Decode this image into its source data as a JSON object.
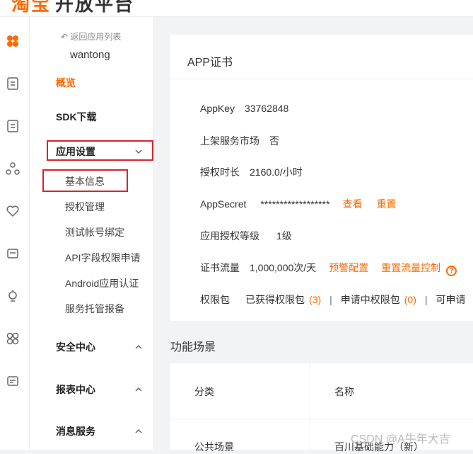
{
  "header": {
    "brand_main": "淘宝",
    "brand_rest": "开放平台"
  },
  "sidebar": {
    "back_label": "返回应用列表",
    "app_name": "wantong",
    "overview": "概览",
    "sdk": "SDK下载",
    "app_settings": "应用设置",
    "sub_items": [
      "基本信息",
      "授权管理",
      "测试帐号绑定",
      "API字段权限申请",
      "Android应用认证",
      "服务托管报备"
    ],
    "security": "安全中心",
    "reports": "报表中心",
    "messages": "消息服务"
  },
  "cert": {
    "title": "APP证书",
    "appkey_label": "AppKey",
    "appkey_value": "33762848",
    "market_label": "上架服务市场",
    "market_value": "否",
    "duration_label": "授权时长",
    "duration_value": "2160.0/小时",
    "secret_label": "AppSecret",
    "secret_value": "******************",
    "view_link": "查看",
    "reset_link": "重置",
    "level_label": "应用授权等级",
    "level_value": "1级",
    "traffic_label": "证书流量",
    "traffic_value": "1,000,000次/天",
    "alert_link": "预警配置",
    "reset_traffic_link": "重置流量控制",
    "perm_label": "权限包",
    "obtained_label": "已获得权限包",
    "obtained_count": "(3)",
    "applying_label": "申请中权限包",
    "applying_count": "(0)",
    "applicable_label": "可申请"
  },
  "scenes": {
    "title": "功能场景",
    "col_category": "分类",
    "col_name": "名称",
    "row_category": "公共场景",
    "row_name": "百川基础能力（新）"
  },
  "watermark": "CSDN @A牛年大吉",
  "colors": {
    "accent": "#ff6a00",
    "highlight_box": "#d9242b"
  }
}
